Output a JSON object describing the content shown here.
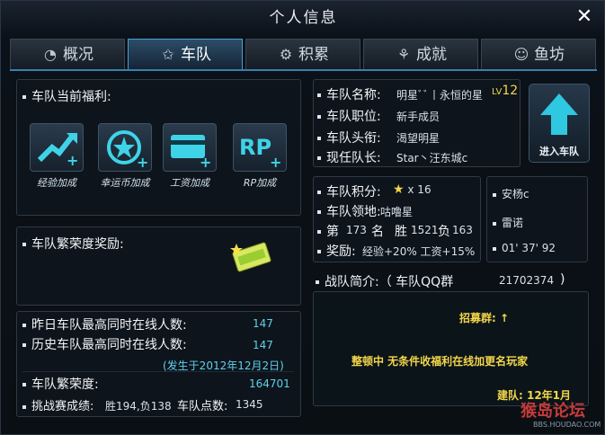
{
  "window": {
    "title": "个人信息",
    "close_glyph": "✕"
  },
  "tabs": [
    {
      "label": "概况",
      "icon": "gauge-icon"
    },
    {
      "label": "车队",
      "icon": "star-icon",
      "active": true
    },
    {
      "label": "积累",
      "icon": "gear-icon"
    },
    {
      "label": "成就",
      "icon": "medal-icon"
    },
    {
      "label": "鱼坊",
      "icon": "fish-icon"
    }
  ],
  "benefits": {
    "heading": "车队当前福利:",
    "items": [
      {
        "label": "经验加成",
        "icon": "exp-boost-icon"
      },
      {
        "label": "幸运币加成",
        "icon": "lucky-coin-icon"
      },
      {
        "label": "工资加成",
        "icon": "salary-card-icon"
      },
      {
        "label": "RP加成",
        "icon": "rp-boost-icon",
        "glyph": "RP"
      }
    ]
  },
  "prosperity_reward": {
    "heading": "车队繁荣度奖励:",
    "badge_icon": "reward-ticket-icon"
  },
  "stats": {
    "yesterday_peak_label": "昨日车队最高同时在线人数:",
    "yesterday_peak_value": "147",
    "history_peak_label": "历史车队最高同时在线人数:",
    "history_peak_value": "147",
    "history_peak_date": "(发生于2012年12月2日)",
    "prosperity_label": "车队繁荣度:",
    "prosperity_value": "164701",
    "challenge_label": "挑战赛成绩:",
    "challenge_value": "胜194,负138",
    "team_points_label": "车队点数:",
    "team_points_value": "1345"
  },
  "team_info": {
    "name_label": "车队名称:",
    "name_value": "明星ﾞﾞ丨永恒的星",
    "level_prefix": "LV",
    "level_value": "12",
    "position_label": "车队职位:",
    "position_value": "新手成员",
    "title_label": "车队头衔:",
    "title_value": "渴望明星",
    "captain_label": "现任队长:",
    "captain_value": "Star丶汪东城c"
  },
  "enter_team": {
    "label": "进入车队",
    "icon": "up-arrow-icon"
  },
  "team_score": {
    "points_label": "车队积分:",
    "points_star": "★",
    "points_value": "x 16",
    "territory_label": "车队领地:",
    "territory_value": "咕噜星",
    "rank_prefix": "第",
    "rank_value": "173",
    "rank_suffix": "名",
    "wins_label": "胜",
    "wins_value": "1521",
    "losses_label": "负",
    "losses_value": "163",
    "reward_label": "奖励:",
    "reward_value": "经验+20% 工资+15%"
  },
  "side_info": {
    "line1": "安杨c",
    "line2": "雷诺",
    "line3": "01' 37' 92"
  },
  "intro": {
    "heading": "战队简介:（ 车队QQ群",
    "qq": "21702374",
    "close_paren": ")",
    "recruit": "招募群: ↑",
    "notice": "整顿中  无条件收福利在线加更名玩家",
    "founded": "建队: 12年1月"
  },
  "watermark": {
    "brand": "猴岛论坛",
    "url": "BBS.HOUDAO.COM"
  },
  "colors": {
    "accent": "#4a9ed8",
    "cyan": "#5fd0ee",
    "yellow": "#f3d64a"
  }
}
